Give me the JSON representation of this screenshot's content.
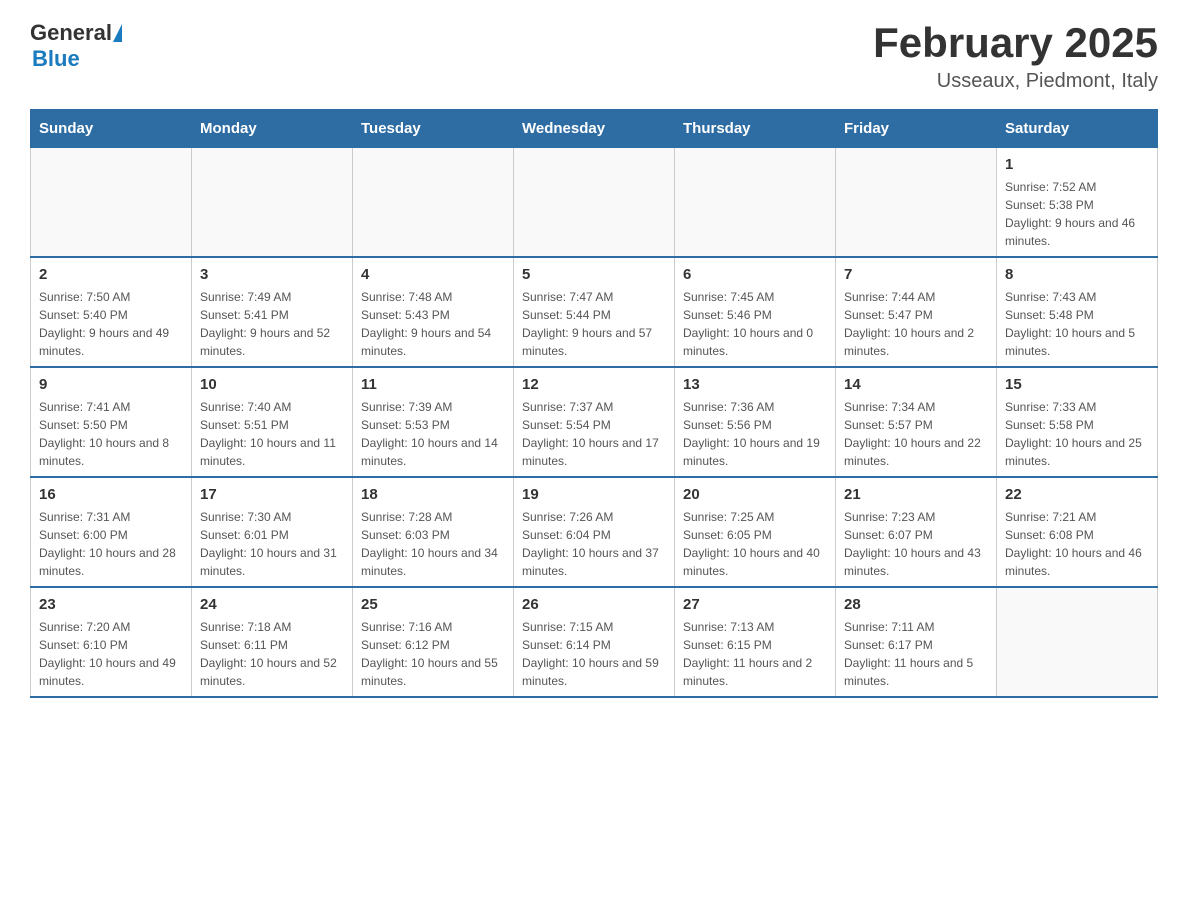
{
  "header": {
    "logo_general": "General",
    "logo_blue": "Blue",
    "month_title": "February 2025",
    "location": "Usseaux, Piedmont, Italy"
  },
  "weekdays": [
    "Sunday",
    "Monday",
    "Tuesday",
    "Wednesday",
    "Thursday",
    "Friday",
    "Saturday"
  ],
  "weeks": [
    [
      {
        "day": "",
        "info": ""
      },
      {
        "day": "",
        "info": ""
      },
      {
        "day": "",
        "info": ""
      },
      {
        "day": "",
        "info": ""
      },
      {
        "day": "",
        "info": ""
      },
      {
        "day": "",
        "info": ""
      },
      {
        "day": "1",
        "info": "Sunrise: 7:52 AM\nSunset: 5:38 PM\nDaylight: 9 hours and 46 minutes."
      }
    ],
    [
      {
        "day": "2",
        "info": "Sunrise: 7:50 AM\nSunset: 5:40 PM\nDaylight: 9 hours and 49 minutes."
      },
      {
        "day": "3",
        "info": "Sunrise: 7:49 AM\nSunset: 5:41 PM\nDaylight: 9 hours and 52 minutes."
      },
      {
        "day": "4",
        "info": "Sunrise: 7:48 AM\nSunset: 5:43 PM\nDaylight: 9 hours and 54 minutes."
      },
      {
        "day": "5",
        "info": "Sunrise: 7:47 AM\nSunset: 5:44 PM\nDaylight: 9 hours and 57 minutes."
      },
      {
        "day": "6",
        "info": "Sunrise: 7:45 AM\nSunset: 5:46 PM\nDaylight: 10 hours and 0 minutes."
      },
      {
        "day": "7",
        "info": "Sunrise: 7:44 AM\nSunset: 5:47 PM\nDaylight: 10 hours and 2 minutes."
      },
      {
        "day": "8",
        "info": "Sunrise: 7:43 AM\nSunset: 5:48 PM\nDaylight: 10 hours and 5 minutes."
      }
    ],
    [
      {
        "day": "9",
        "info": "Sunrise: 7:41 AM\nSunset: 5:50 PM\nDaylight: 10 hours and 8 minutes."
      },
      {
        "day": "10",
        "info": "Sunrise: 7:40 AM\nSunset: 5:51 PM\nDaylight: 10 hours and 11 minutes."
      },
      {
        "day": "11",
        "info": "Sunrise: 7:39 AM\nSunset: 5:53 PM\nDaylight: 10 hours and 14 minutes."
      },
      {
        "day": "12",
        "info": "Sunrise: 7:37 AM\nSunset: 5:54 PM\nDaylight: 10 hours and 17 minutes."
      },
      {
        "day": "13",
        "info": "Sunrise: 7:36 AM\nSunset: 5:56 PM\nDaylight: 10 hours and 19 minutes."
      },
      {
        "day": "14",
        "info": "Sunrise: 7:34 AM\nSunset: 5:57 PM\nDaylight: 10 hours and 22 minutes."
      },
      {
        "day": "15",
        "info": "Sunrise: 7:33 AM\nSunset: 5:58 PM\nDaylight: 10 hours and 25 minutes."
      }
    ],
    [
      {
        "day": "16",
        "info": "Sunrise: 7:31 AM\nSunset: 6:00 PM\nDaylight: 10 hours and 28 minutes."
      },
      {
        "day": "17",
        "info": "Sunrise: 7:30 AM\nSunset: 6:01 PM\nDaylight: 10 hours and 31 minutes."
      },
      {
        "day": "18",
        "info": "Sunrise: 7:28 AM\nSunset: 6:03 PM\nDaylight: 10 hours and 34 minutes."
      },
      {
        "day": "19",
        "info": "Sunrise: 7:26 AM\nSunset: 6:04 PM\nDaylight: 10 hours and 37 minutes."
      },
      {
        "day": "20",
        "info": "Sunrise: 7:25 AM\nSunset: 6:05 PM\nDaylight: 10 hours and 40 minutes."
      },
      {
        "day": "21",
        "info": "Sunrise: 7:23 AM\nSunset: 6:07 PM\nDaylight: 10 hours and 43 minutes."
      },
      {
        "day": "22",
        "info": "Sunrise: 7:21 AM\nSunset: 6:08 PM\nDaylight: 10 hours and 46 minutes."
      }
    ],
    [
      {
        "day": "23",
        "info": "Sunrise: 7:20 AM\nSunset: 6:10 PM\nDaylight: 10 hours and 49 minutes."
      },
      {
        "day": "24",
        "info": "Sunrise: 7:18 AM\nSunset: 6:11 PM\nDaylight: 10 hours and 52 minutes."
      },
      {
        "day": "25",
        "info": "Sunrise: 7:16 AM\nSunset: 6:12 PM\nDaylight: 10 hours and 55 minutes."
      },
      {
        "day": "26",
        "info": "Sunrise: 7:15 AM\nSunset: 6:14 PM\nDaylight: 10 hours and 59 minutes."
      },
      {
        "day": "27",
        "info": "Sunrise: 7:13 AM\nSunset: 6:15 PM\nDaylight: 11 hours and 2 minutes."
      },
      {
        "day": "28",
        "info": "Sunrise: 7:11 AM\nSunset: 6:17 PM\nDaylight: 11 hours and 5 minutes."
      },
      {
        "day": "",
        "info": ""
      }
    ]
  ]
}
